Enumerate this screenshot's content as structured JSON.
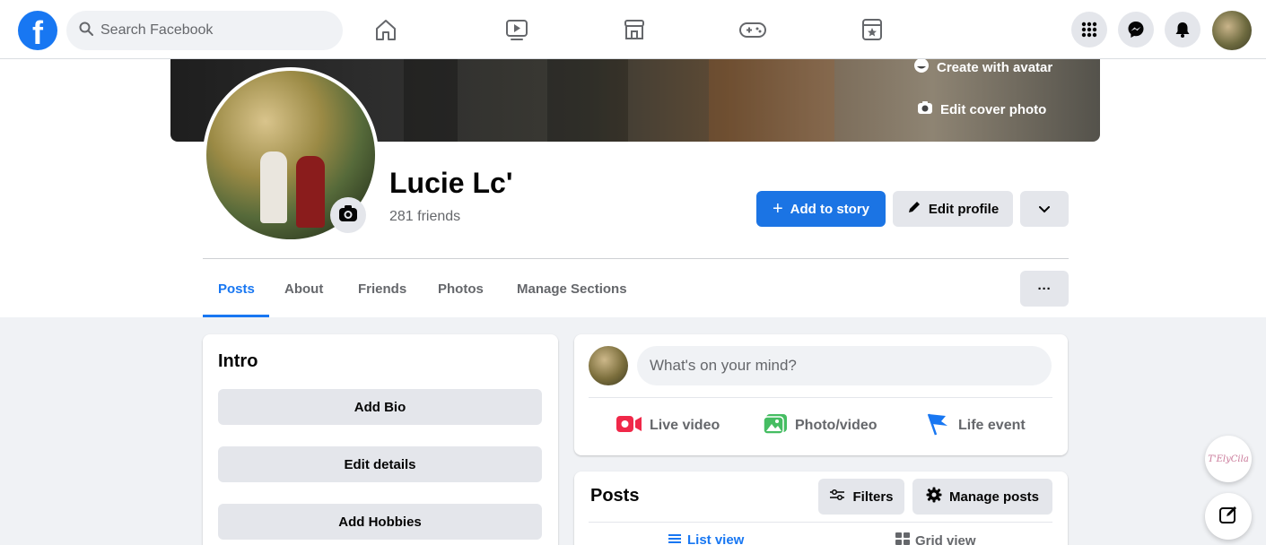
{
  "topbar": {
    "search_placeholder": "Search Facebook",
    "nav_icons": [
      "home-icon",
      "watch-icon",
      "marketplace-icon",
      "gaming-icon",
      "pages-icon"
    ],
    "right_icons": [
      "menu-grid-icon",
      "messenger-icon",
      "notifications-icon"
    ]
  },
  "cover": {
    "create_avatar_label": "Create with avatar",
    "edit_cover_label": "Edit cover photo"
  },
  "profile": {
    "name": "Lucie Lc'",
    "friends": "281 friends",
    "add_story_label": "Add to story",
    "edit_profile_label": "Edit profile"
  },
  "tabs": [
    {
      "label": "Posts",
      "active": true
    },
    {
      "label": "About"
    },
    {
      "label": "Friends"
    },
    {
      "label": "Photos"
    },
    {
      "label": "Manage Sections"
    }
  ],
  "more_label": "···",
  "intro": {
    "title": "Intro",
    "buttons": [
      "Add Bio",
      "Edit details",
      "Add Hobbies"
    ]
  },
  "composer": {
    "placeholder": "What's on your mind?",
    "actions": [
      "Live video",
      "Photo/video",
      "Life event"
    ]
  },
  "posts_section": {
    "title": "Posts",
    "filters_label": "Filters",
    "manage_label": "Manage posts",
    "list_view_label": "List view",
    "grid_view_label": "Grid view"
  },
  "floating": {
    "badge_text": "T'ElyCila"
  },
  "colors": {
    "brand": "#1877f2",
    "button_blue": "#1b74e4",
    "gray_button": "#e4e6eb",
    "background": "#f0f2f5"
  }
}
